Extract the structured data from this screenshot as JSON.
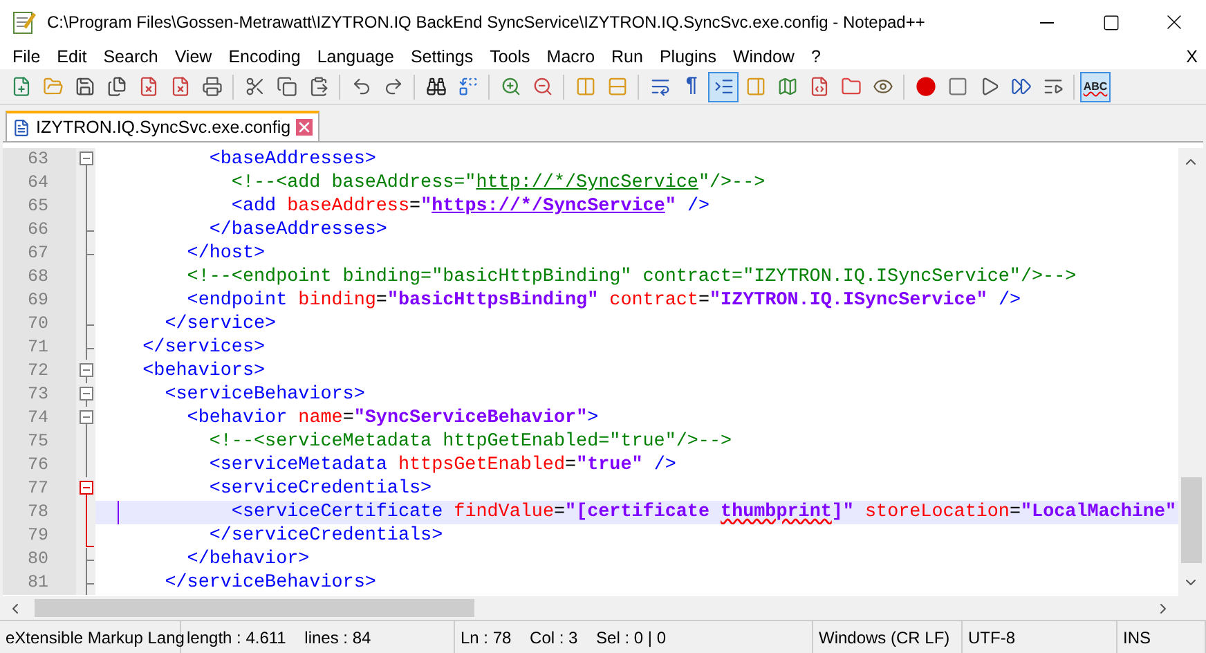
{
  "window": {
    "title": "C:\\Program Files\\Gossen-Metrawatt\\IZYTRON.IQ BackEnd SyncService\\IZYTRON.IQ.SyncSvc.exe.config - Notepad++"
  },
  "menu": [
    "File",
    "Edit",
    "Search",
    "View",
    "Encoding",
    "Language",
    "Settings",
    "Tools",
    "Macro",
    "Run",
    "Plugins",
    "Window",
    "?"
  ],
  "menu_close": "X",
  "toolbar": [
    {
      "kind": "button",
      "pressed": false
    },
    {
      "kind": "button",
      "pressed": false
    },
    {
      "kind": "button",
      "pressed": false
    },
    {
      "kind": "button",
      "pressed": false
    },
    {
      "kind": "button",
      "pressed": false
    },
    {
      "kind": "button",
      "pressed": false
    },
    {
      "kind": "button",
      "pressed": false
    },
    {
      "kind": "separator"
    },
    {
      "kind": "button",
      "pressed": false
    },
    {
      "kind": "button",
      "pressed": false
    },
    {
      "kind": "button",
      "pressed": false
    },
    {
      "kind": "separator"
    },
    {
      "kind": "button",
      "pressed": false
    },
    {
      "kind": "button",
      "pressed": false
    },
    {
      "kind": "separator"
    },
    {
      "kind": "button",
      "pressed": false
    },
    {
      "kind": "button",
      "pressed": false
    },
    {
      "kind": "separator"
    },
    {
      "kind": "button",
      "pressed": false
    },
    {
      "kind": "button",
      "pressed": false
    },
    {
      "kind": "separator"
    },
    {
      "kind": "button",
      "pressed": false
    },
    {
      "kind": "button",
      "pressed": false
    },
    {
      "kind": "separator"
    },
    {
      "kind": "button",
      "pressed": false
    },
    {
      "kind": "label",
      "label": "¶",
      "pressed": false
    },
    {
      "kind": "button",
      "pressed": true
    },
    {
      "kind": "button",
      "pressed": false
    },
    {
      "kind": "button",
      "pressed": false
    },
    {
      "kind": "button",
      "pressed": false
    },
    {
      "kind": "button",
      "pressed": false
    },
    {
      "kind": "button",
      "pressed": false
    },
    {
      "kind": "separator"
    },
    {
      "kind": "button",
      "pressed": false
    },
    {
      "kind": "button",
      "pressed": false
    },
    {
      "kind": "button",
      "pressed": false
    },
    {
      "kind": "button",
      "pressed": false
    },
    {
      "kind": "button",
      "pressed": false
    },
    {
      "kind": "separator"
    },
    {
      "kind": "label",
      "label": "ABC",
      "pressed": true
    }
  ],
  "tabs": [
    {
      "label": "IZYTRON.IQ.SyncSvc.exe.config",
      "selected": true
    }
  ],
  "editor": {
    "lines": [
      {
        "number": "63",
        "kind": "start",
        "active": false,
        "current": false,
        "tokens": [
          {
            "kind": "tag",
            "text": "          <baseAddresses>"
          }
        ]
      },
      {
        "number": "64",
        "kind": "body",
        "active": false,
        "current": false,
        "tokens": [
          {
            "kind": "comment",
            "text": "            <!--<add baseAddress=\""
          },
          {
            "kind": "comment-link",
            "text": "http://*/SyncService"
          },
          {
            "kind": "comment",
            "text": "\"/>-->"
          }
        ]
      },
      {
        "number": "65",
        "kind": "body",
        "active": false,
        "current": false,
        "tokens": [
          {
            "kind": "tag",
            "text": "            <add "
          },
          {
            "kind": "attr",
            "text": "baseAddress"
          },
          {
            "kind": "eq",
            "text": "="
          },
          {
            "kind": "value",
            "text": "\""
          },
          {
            "kind": "value-link",
            "text": "https://*/SyncService"
          },
          {
            "kind": "value",
            "text": "\" "
          },
          {
            "kind": "tag",
            "text": "/>"
          }
        ]
      },
      {
        "number": "66",
        "kind": "end",
        "active": false,
        "current": false,
        "tokens": [
          {
            "kind": "tag",
            "text": "          </baseAddresses>"
          }
        ]
      },
      {
        "number": "67",
        "kind": "end",
        "active": false,
        "current": false,
        "tokens": [
          {
            "kind": "tag",
            "text": "        </host>"
          }
        ]
      },
      {
        "number": "68",
        "kind": "body",
        "active": false,
        "current": false,
        "tokens": [
          {
            "kind": "comment",
            "text": "        <!--<endpoint binding=\"basicHttpBinding\" contract=\"IZYTRON.IQ.ISyncService\"/>-->"
          }
        ]
      },
      {
        "number": "69",
        "kind": "body",
        "active": false,
        "current": false,
        "tokens": [
          {
            "kind": "tag",
            "text": "        <endpoint "
          },
          {
            "kind": "attr",
            "text": "binding"
          },
          {
            "kind": "eq",
            "text": "="
          },
          {
            "kind": "value",
            "text": "\"basicHttpsBinding\" "
          },
          {
            "kind": "attr",
            "text": "contract"
          },
          {
            "kind": "eq",
            "text": "="
          },
          {
            "kind": "value",
            "text": "\"IZYTRON.IQ.ISyncService\" "
          },
          {
            "kind": "tag",
            "text": "/>"
          }
        ]
      },
      {
        "number": "70",
        "kind": "end",
        "active": false,
        "current": false,
        "tokens": [
          {
            "kind": "tag",
            "text": "      </service>"
          }
        ]
      },
      {
        "number": "71",
        "kind": "end",
        "active": false,
        "current": false,
        "tokens": [
          {
            "kind": "tag",
            "text": "    </services>"
          }
        ]
      },
      {
        "number": "72",
        "kind": "start",
        "active": false,
        "current": false,
        "tokens": [
          {
            "kind": "tag",
            "text": "    <behaviors>"
          }
        ]
      },
      {
        "number": "73",
        "kind": "start",
        "active": false,
        "current": false,
        "tokens": [
          {
            "kind": "tag",
            "text": "      <serviceBehaviors>"
          }
        ]
      },
      {
        "number": "74",
        "kind": "start",
        "active": false,
        "current": false,
        "tokens": [
          {
            "kind": "tag",
            "text": "        <behavior "
          },
          {
            "kind": "attr",
            "text": "name"
          },
          {
            "kind": "eq",
            "text": "="
          },
          {
            "kind": "value",
            "text": "\"SyncServiceBehavior\""
          },
          {
            "kind": "tag",
            "text": ">"
          }
        ]
      },
      {
        "number": "75",
        "kind": "body",
        "active": false,
        "current": false,
        "tokens": [
          {
            "kind": "comment",
            "text": "          <!--<serviceMetadata httpGetEnabled=\"true\"/>-->"
          }
        ]
      },
      {
        "number": "76",
        "kind": "body",
        "active": false,
        "current": false,
        "tokens": [
          {
            "kind": "tag",
            "text": "          <serviceMetadata "
          },
          {
            "kind": "attr",
            "text": "httpsGetEnabled"
          },
          {
            "kind": "eq",
            "text": "="
          },
          {
            "kind": "value",
            "text": "\"true\" "
          },
          {
            "kind": "tag",
            "text": "/>"
          }
        ]
      },
      {
        "number": "77",
        "kind": "start",
        "active": true,
        "current": false,
        "tokens": [
          {
            "kind": "tag",
            "text": "          <serviceCredentials>"
          }
        ]
      },
      {
        "number": "78",
        "kind": "body",
        "active": true,
        "current": true,
        "tokens": [
          {
            "kind": "tag",
            "text": "            <serviceCertificate "
          },
          {
            "kind": "attr",
            "text": "findValue"
          },
          {
            "kind": "eq",
            "text": "="
          },
          {
            "kind": "value",
            "text": "\"[certificate "
          },
          {
            "kind": "value-spell",
            "text": "thumbprint"
          },
          {
            "kind": "value",
            "text": "]\" "
          },
          {
            "kind": "attr",
            "text": "storeLocation"
          },
          {
            "kind": "eq",
            "text": "="
          },
          {
            "kind": "value",
            "text": "\"LocalMachine\""
          }
        ]
      },
      {
        "number": "79",
        "kind": "end",
        "active": true,
        "current": false,
        "tokens": [
          {
            "kind": "tag",
            "text": "          </serviceCredentials>"
          }
        ]
      },
      {
        "number": "80",
        "kind": "end",
        "active": false,
        "current": false,
        "tokens": [
          {
            "kind": "tag",
            "text": "        </behavior>"
          }
        ]
      },
      {
        "number": "81",
        "kind": "end",
        "active": false,
        "current": false,
        "tokens": [
          {
            "kind": "tag",
            "text": "      </serviceBehaviors>"
          }
        ]
      }
    ]
  },
  "status_bar": [
    "eXtensible Markup Lang",
    "length : 4.611    lines : 84",
    "Ln : 78    Col : 3    Sel : 0 | 0",
    "Windows (CR LF)",
    "UTF-8",
    "INS"
  ]
}
